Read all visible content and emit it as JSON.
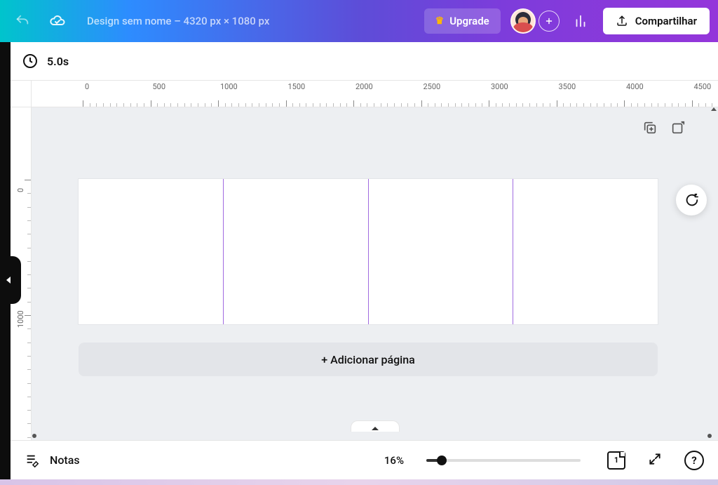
{
  "header": {
    "doc_title": "Design sem nome – 4320 px × 1080 px",
    "upgrade_label": "Upgrade",
    "share_label": "Compartilhar"
  },
  "timing": {
    "duration": "5.0s"
  },
  "ruler_h": {
    "labels": [
      "0",
      "500",
      "1000",
      "1500",
      "2000",
      "2500",
      "3000",
      "3500",
      "4000",
      "4500"
    ]
  },
  "ruler_v": {
    "labels": [
      "0",
      "1000"
    ]
  },
  "canvas": {
    "add_page_label": "+ Adicionar página"
  },
  "footer": {
    "notes_label": "Notas",
    "zoom_label": "16%",
    "zoom_percent": 16,
    "page_count": "1",
    "help_label": "?"
  }
}
